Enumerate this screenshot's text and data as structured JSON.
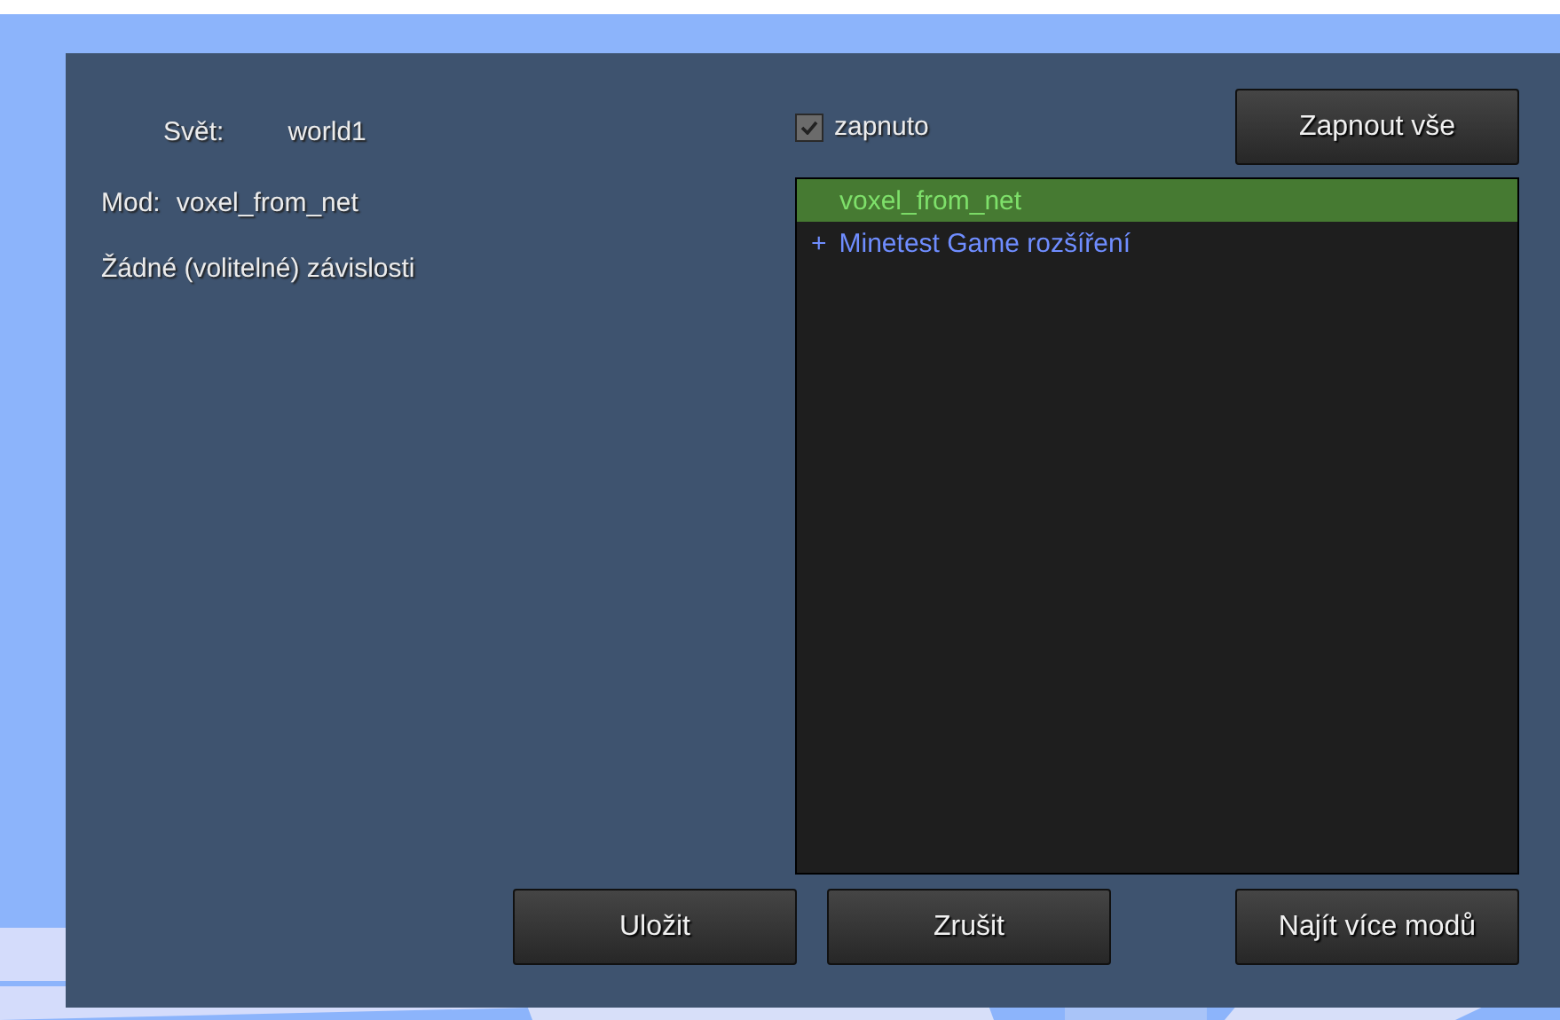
{
  "world": {
    "label": "Svět:",
    "value": "world1"
  },
  "mod": {
    "label": "Mod:",
    "value": "voxel_from_net"
  },
  "dependencies": "Žádné (volitelné) závislosti",
  "enabled_checkbox": {
    "label": "zapnuto",
    "checked": true
  },
  "enable_all_button": "Zapnout vše",
  "mod_list": [
    {
      "kind": "mod",
      "name": "voxel_from_net",
      "selected": true
    },
    {
      "kind": "modpack",
      "name": "Minetest Game rozšíření",
      "expander": "+",
      "expanded": false,
      "selected": false
    }
  ],
  "buttons": [
    "Uložit",
    "Zrušit",
    "Najít více modů"
  ]
}
